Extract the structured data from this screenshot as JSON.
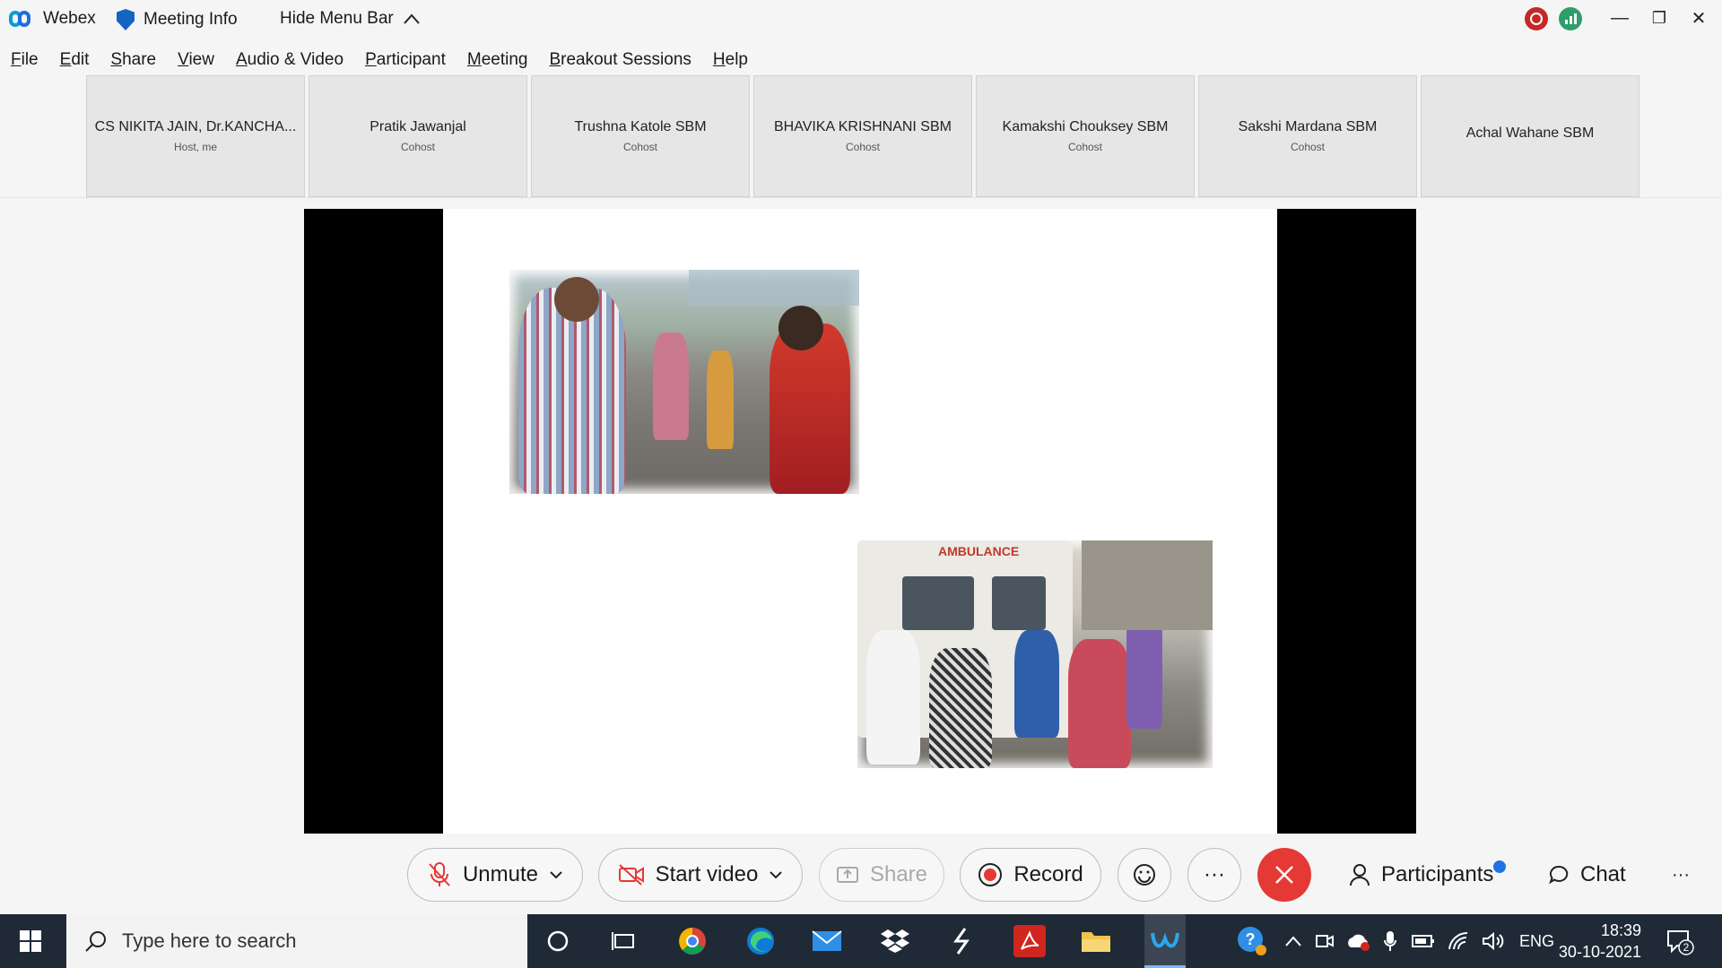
{
  "titlebar": {
    "app_name": "Webex",
    "meeting_info": "Meeting Info",
    "hide_menu": "Hide Menu Bar",
    "minimize": "—",
    "restore": "❐",
    "close": "✕"
  },
  "menu": [
    "File",
    "Edit",
    "Share",
    "View",
    "Audio & Video",
    "Participant",
    "Meeting",
    "Breakout Sessions",
    "Help"
  ],
  "participants": [
    {
      "name": "CS NIKITA JAIN, Dr.KANCHA...",
      "role": "Host, me"
    },
    {
      "name": "Pratik Jawanjal",
      "role": "Cohost"
    },
    {
      "name": "Trushna Katole SBM",
      "role": "Cohost"
    },
    {
      "name": "BHAVIKA KRISHNANI SBM",
      "role": "Cohost"
    },
    {
      "name": "Kamakshi Chouksey SBM",
      "role": "Cohost"
    },
    {
      "name": "Sakshi Mardana SBM",
      "role": "Cohost"
    },
    {
      "name": "Achal Wahane SBM",
      "role": ""
    }
  ],
  "slide": {
    "photo2_caption": "AMBULANCE"
  },
  "controls": {
    "unmute": "Unmute",
    "start_video": "Start video",
    "share": "Share",
    "record": "Record",
    "more": "···",
    "participants": "Participants",
    "chat": "Chat",
    "overflow": "···"
  },
  "taskbar": {
    "search_placeholder": "Type here to search",
    "language": "ENG",
    "time": "18:39",
    "date": "30-10-2021",
    "notifications": "2"
  },
  "colors": {
    "end_call": "#e53935",
    "record_dot": "#e53935",
    "taskbar": "#1f2a36",
    "participants_badge": "#1e74e6"
  }
}
